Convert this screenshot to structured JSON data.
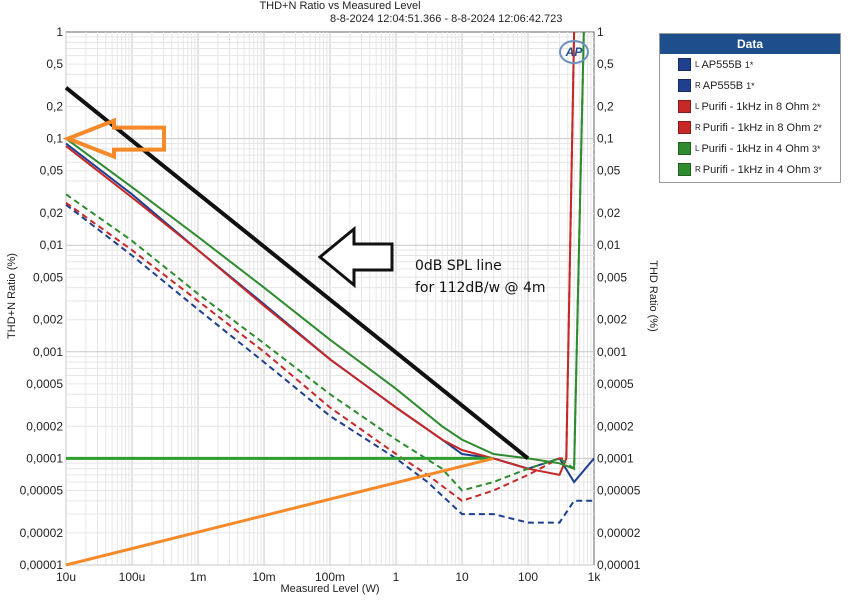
{
  "chart_data": {
    "type": "line",
    "title": "THD+N Ratio vs Measured Level",
    "subtitle": "8-8-2024 12:04:51.366 - 8-8-2024 12:06:42.723",
    "xlabel": "Measured Level (W)",
    "ylabel": "THD+N Ratio (%)",
    "ylabel_right": "THD Ratio (%)",
    "xscale": "log",
    "yscale": "log",
    "xlim": [
      1e-05,
      1000
    ],
    "ylim": [
      1e-05,
      1
    ],
    "grid": true,
    "legend_placement": "top-right outside",
    "legend_title": "Data",
    "x_ticks": [
      {
        "value": 1e-05,
        "label": "10u"
      },
      {
        "value": 0.0001,
        "label": "100u"
      },
      {
        "value": 0.001,
        "label": "1m"
      },
      {
        "value": 0.01,
        "label": "10m"
      },
      {
        "value": 0.1,
        "label": "100m"
      },
      {
        "value": 1,
        "label": "1"
      },
      {
        "value": 10,
        "label": "10"
      },
      {
        "value": 100,
        "label": "100"
      },
      {
        "value": 1000,
        "label": "1k"
      }
    ],
    "y_ticks": [
      {
        "value": 1,
        "label": "1"
      },
      {
        "value": 0.5,
        "label": "0,5"
      },
      {
        "value": 0.2,
        "label": "0,2"
      },
      {
        "value": 0.1,
        "label": "0,1"
      },
      {
        "value": 0.05,
        "label": "0,05"
      },
      {
        "value": 0.02,
        "label": "0,02"
      },
      {
        "value": 0.01,
        "label": "0,01"
      },
      {
        "value": 0.005,
        "label": "0,005"
      },
      {
        "value": 0.002,
        "label": "0,002"
      },
      {
        "value": 0.001,
        "label": "0,001"
      },
      {
        "value": 0.0005,
        "label": "0,0005"
      },
      {
        "value": 0.0002,
        "label": "0,0002"
      },
      {
        "value": 0.0001,
        "label": "0,0001"
      },
      {
        "value": 5e-05,
        "label": "0,00005"
      },
      {
        "value": 2e-05,
        "label": "0,00002"
      },
      {
        "value": 1e-05,
        "label": "0,00001"
      }
    ],
    "series": [
      {
        "channel": "L",
        "name": "AP555B",
        "index": "1*",
        "color": "#1f3f8f",
        "dash": false,
        "x": [
          1e-05,
          0.0001,
          0.001,
          0.01,
          0.1,
          1,
          5,
          10,
          30,
          100,
          300,
          500,
          1000
        ],
        "y": [
          0.09,
          0.03,
          0.009,
          0.0028,
          0.00085,
          0.0003,
          0.00015,
          0.00011,
          0.0001,
          8e-05,
          0.0001,
          6e-05,
          0.0001
        ]
      },
      {
        "channel": "R",
        "name": "AP555B",
        "index": "1*",
        "color": "#1f3f8f",
        "dash": true,
        "x": [
          1e-05,
          0.0001,
          0.001,
          0.01,
          0.1,
          1,
          3,
          10,
          30,
          100,
          300,
          500,
          1000
        ],
        "y": [
          0.024,
          0.008,
          0.0025,
          0.0008,
          0.00025,
          0.0001,
          6e-05,
          3e-05,
          3e-05,
          2.5e-05,
          2.5e-05,
          4e-05,
          4e-05
        ]
      },
      {
        "channel": "L",
        "name": "Purifi - 1kHz in 8 Ohm",
        "index": "2*",
        "color": "#c62828",
        "dash": false,
        "x": [
          1e-05,
          0.0001,
          0.001,
          0.01,
          0.1,
          1,
          5,
          10,
          30,
          100,
          300,
          380,
          500
        ],
        "y": [
          0.085,
          0.028,
          0.009,
          0.0027,
          0.00085,
          0.0003,
          0.00015,
          0.00012,
          0.0001,
          8e-05,
          7e-05,
          0.0001,
          1
        ]
      },
      {
        "channel": "R",
        "name": "Purifi - 1kHz in 8 Ohm",
        "index": "2*",
        "color": "#c62828",
        "dash": true,
        "x": [
          1e-05,
          0.0001,
          0.001,
          0.01,
          0.1,
          1,
          3,
          10,
          30,
          100,
          300,
          380,
          500
        ],
        "y": [
          0.025,
          0.009,
          0.003,
          0.001,
          0.0003,
          0.00011,
          7e-05,
          4e-05,
          5e-05,
          7e-05,
          0.0001,
          0.0001,
          1
        ]
      },
      {
        "channel": "L",
        "name": "Purifi - 1kHz in 4 Ohm",
        "index": "3*",
        "color": "#2e8b2e",
        "dash": false,
        "x": [
          1e-05,
          0.0001,
          0.001,
          0.01,
          0.1,
          1,
          5,
          10,
          30,
          100,
          300,
          500,
          700
        ],
        "y": [
          0.1,
          0.035,
          0.012,
          0.004,
          0.0013,
          0.00045,
          0.0002,
          0.00015,
          0.00011,
          0.0001,
          9e-05,
          8e-05,
          1
        ]
      },
      {
        "channel": "R",
        "name": "Purifi - 1kHz in 4 Ohm",
        "index": "3*",
        "color": "#2e8b2e",
        "dash": true,
        "x": [
          1e-05,
          0.0001,
          0.001,
          0.01,
          0.1,
          1,
          5,
          10,
          30,
          100,
          300,
          500,
          700
        ],
        "y": [
          0.03,
          0.011,
          0.0035,
          0.0012,
          0.0004,
          0.00015,
          8e-05,
          5e-05,
          6e-05,
          8e-05,
          0.0001,
          8e-05,
          1
        ]
      }
    ],
    "overlays": [
      {
        "kind": "line",
        "color": "#111111",
        "x": [
          1e-05,
          100
        ],
        "y": [
          0.3,
          0.0001
        ]
      },
      {
        "kind": "line",
        "color": "#2e9e2e",
        "x": [
          1e-05,
          30
        ],
        "y": [
          0.0001,
          0.0001
        ]
      },
      {
        "kind": "line",
        "color": "#f58a2a",
        "x": [
          1e-05,
          30
        ],
        "y": [
          1e-05,
          0.0001
        ]
      }
    ],
    "annotations": [
      {
        "text": "0dB SPL line"
      },
      {
        "text": "for 112dB/w @ 4m"
      }
    ]
  },
  "logo_text": "AP"
}
